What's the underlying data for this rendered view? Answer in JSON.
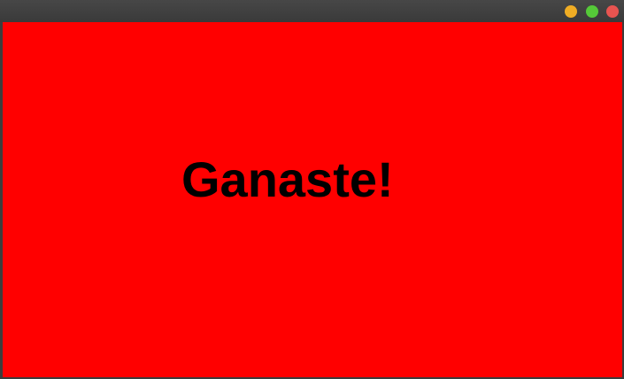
{
  "window": {
    "controls": [
      "minimize",
      "maximize",
      "close"
    ],
    "colors": {
      "minimize": "#f0ad24",
      "maximize": "#55c938",
      "close": "#e95450",
      "background": "#ff0000"
    }
  },
  "content": {
    "message": "Ganaste!"
  }
}
